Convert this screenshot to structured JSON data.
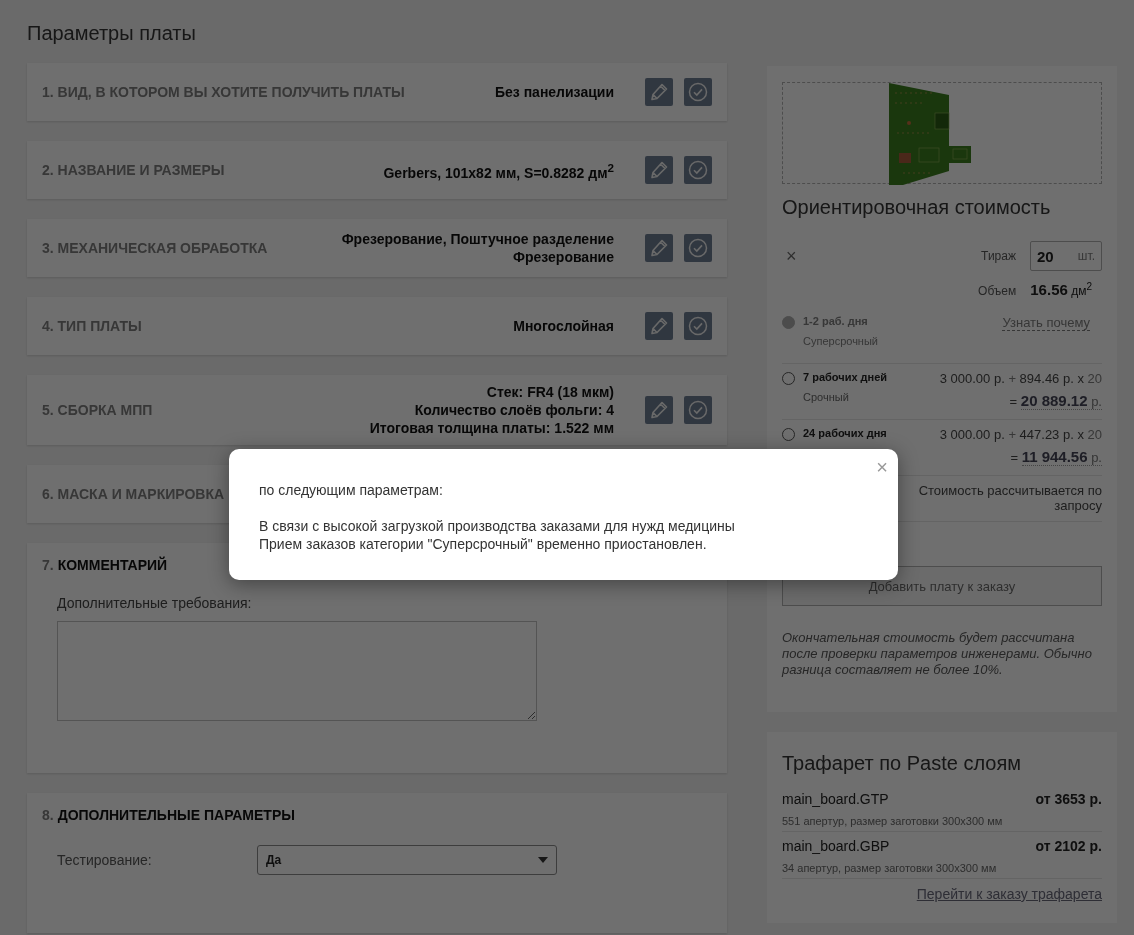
{
  "page_title": "Параметры платы",
  "sections": [
    {
      "kind": "summary",
      "number": "1.",
      "title": "ВИД, В КОТОРОМ ВЫ ХОТИТЕ ПОЛУЧИТЬ ПЛАТЫ",
      "value_lines": [
        "Без панелизации"
      ]
    },
    {
      "kind": "summary",
      "number": "2.",
      "title": "НАЗВАНИЕ И РАЗМЕРЫ",
      "value_lines": [
        "Gerbers, 101x82 мм, S=0.8282 дм$^{2}$"
      ]
    },
    {
      "kind": "summary",
      "number": "3.",
      "title": "МЕХАНИЧЕСКАЯ ОБРАБОТКА",
      "value_lines": [
        "Фрезерование, Поштучное разделение",
        "Фрезерование"
      ]
    },
    {
      "kind": "summary",
      "number": "4.",
      "title": "ТИП ПЛАТЫ",
      "value_lines": [
        "Многослойная"
      ]
    },
    {
      "kind": "summary",
      "number": "5.",
      "title": "СБОРКА МПП",
      "value_lines": [
        "Стек: FR4 (18 мкм)",
        "Количество слоёв фольги: 4",
        "Итоговая толщина платы: 1.522 мм"
      ]
    },
    {
      "kind": "summary",
      "number": "6.",
      "title": "МАСКА И МАРКИРОВКА"
    },
    {
      "kind": "comment",
      "number": "7.",
      "title": "КОММЕНТАРИЙ",
      "field_label": "Дополнительные требования:"
    },
    {
      "kind": "options",
      "number": "8.",
      "title": "ДОПОЛНИТЕЛЬНЫЕ ПАРАМЕТРЫ",
      "fields": [
        {
          "label": "Тестирование:",
          "value": "Да"
        }
      ]
    }
  ],
  "cost": {
    "title": "Ориентировочная стоимость",
    "clear": "×",
    "quantity_label": "Тираж",
    "quantity": "20",
    "quantity_unit": "шт.",
    "volume_label": "Объем",
    "volume": "16.56",
    "volume_unit": "дм$^{2}$",
    "options": [
      {
        "kind": "unavailable",
        "label": "1-2 раб. дня",
        "sublabel": "Суперсрочный",
        "link": "Узнать почему",
        "selected": false,
        "disabled": true
      },
      {
        "kind": "priced",
        "label": "7 рабочих дней",
        "sublabel": "Срочный",
        "base": "3 000.00 р.",
        "plus": "+",
        "per_unit": "894.46 р.",
        "times": "x",
        "count": "20",
        "eq": "=",
        "total": "20 889.12",
        "currency": "р.",
        "selected": false,
        "disabled": false
      },
      {
        "kind": "priced",
        "label": "24 рабочих дня",
        "base": "3 000.00 р.",
        "plus": "+",
        "per_unit": "447.23 р.",
        "times": "x",
        "count": "20",
        "eq": "=",
        "total": "11 944.56",
        "currency": "р.",
        "selected": false,
        "disabled": false
      },
      {
        "kind": "on_request",
        "note": "Стоимость рассчитывается по запросу"
      }
    ],
    "add_button": "Добавить плату к заказу",
    "footnote": "Окончательная стоимость будет рассчитана после проверки параметров инженерами. Обычно разница составляет не более 10%."
  },
  "stencil": {
    "title": "Трафарет по Paste слоям",
    "items": [
      {
        "file": "main_board.GTP",
        "price": "от 3653 р.",
        "details": "551 апертур, размер заготовки 300x300 мм"
      },
      {
        "file": "main_board.GBP",
        "price": "от 2102 р.",
        "details": "34 апертур, размер заготовки 300x300 мм"
      }
    ],
    "link": "Перейти к заказу трафарета"
  },
  "modal": {
    "close": "×",
    "lines": [
      "по следующим параметрам:",
      "В связи с высокой загрузкой производства заказами для нужд медицины",
      "Прием заказов категории \"Суперсрочный\" временно приостановлен."
    ]
  }
}
